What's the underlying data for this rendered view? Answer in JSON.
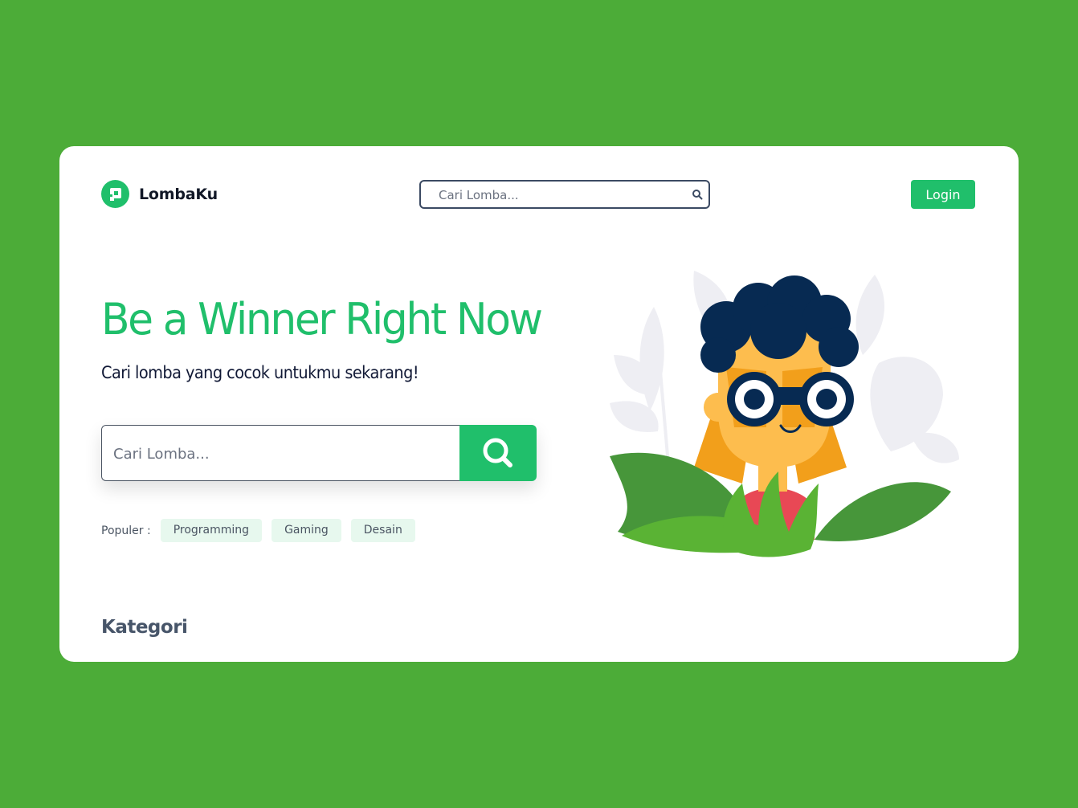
{
  "brand": {
    "name": "LombaKu",
    "icon": "logo-icon"
  },
  "header": {
    "search": {
      "placeholder": "Cari Lomba...",
      "icon": "search-icon"
    },
    "login_label": "Login"
  },
  "hero": {
    "title": "Be a Winner Right Now",
    "subtitle": "Cari lomba yang cocok untukmu sekarang!",
    "search": {
      "placeholder": "Cari Lomba...",
      "icon": "search-icon"
    }
  },
  "populer": {
    "label": "Populer :",
    "tags": [
      "Programming",
      "Gaming",
      "Desain"
    ]
  },
  "section": {
    "kategori": "Kategori"
  },
  "illustration": {
    "icon": "person-with-binoculars-illustration"
  },
  "colors": {
    "background": "#4cac38",
    "accent": "#20bf6b",
    "tag_bg": "#e7f8ee",
    "heading_dark": "#111936"
  }
}
